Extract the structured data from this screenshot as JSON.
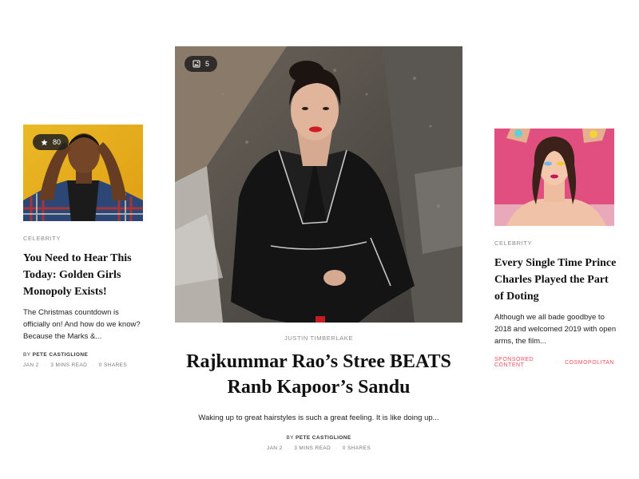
{
  "left_card": {
    "badge_count": "80",
    "badge_icon": "star-icon",
    "category": "CELEBRITY",
    "headline": "You Need to Hear This Today: Golden Girls Monopoly Exists!",
    "excerpt": "The Christmas countdown is officially on! And how do we know? Because the Marks &...",
    "by_prefix": "BY",
    "author": "PETE CASTIGLIONE",
    "date": "JAN 2",
    "read_time": "3 MINS READ",
    "shares": "0 SHARES"
  },
  "center_card": {
    "badge_count": "5",
    "badge_icon": "gallery-icon",
    "category": "JUSTIN TIMBERLAKE",
    "headline": "Rajkummar Rao’s Stree BEATS Ranb Kapoor’s Sandu",
    "excerpt": "Waking up to great hairstyles is such a great feeling. It is like doing up...",
    "by_prefix": "BY",
    "author": "PETE CASTIGLIONE",
    "date": "JAN 2",
    "read_time": "3 MINS READ",
    "shares": "0 SHARES"
  },
  "right_card": {
    "category": "CELEBRITY",
    "headline": "Every Single Time Prince Charles Played the Part of Doting",
    "excerpt": "Although we all bade goodbye to 2018 and welcomed 2019 with open arms, the film...",
    "sponsored_label": "SPONSORED CONTENT",
    "sponsor": "COSMOPOLITAN"
  },
  "colors": {
    "accent_red": "#e9515a",
    "text_dark": "#111111",
    "text_muted": "#8a8a8a"
  }
}
